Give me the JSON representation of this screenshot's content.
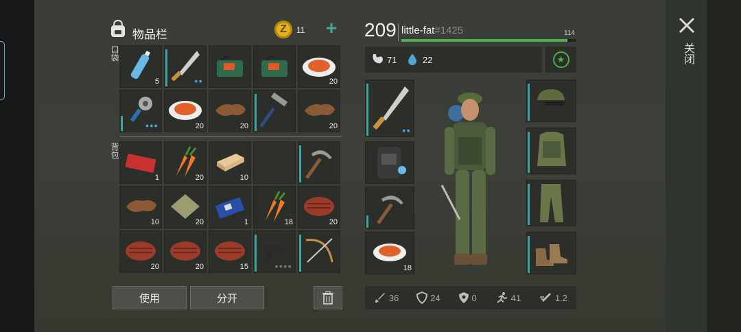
{
  "header": {
    "inventory_title": "物品栏",
    "coins": "11",
    "player_level": "209",
    "player_name": "little-fat",
    "player_tag": "#1425",
    "xp_value": "114",
    "xp_fraction": 0.95,
    "food": "71",
    "water": "22"
  },
  "labels": {
    "pocket": "口袋",
    "backpack": "背包",
    "close": "关闭"
  },
  "buttons": {
    "use": "使用",
    "split": "分开"
  },
  "pocket_counts": [
    "5",
    "",
    "",
    "",
    "20",
    "",
    "20",
    "20",
    "",
    "20"
  ],
  "backpack_counts": [
    "1",
    "20",
    "10",
    "",
    "",
    "10",
    "20",
    "1",
    "18",
    "20",
    "20",
    "20",
    "15",
    "",
    ""
  ],
  "equip_counts": {
    "food": "18"
  },
  "stats": {
    "attack": "36",
    "defense": "24",
    "armor": "0",
    "speed": "41",
    "stealth": "1.2"
  },
  "colors": {
    "accent_green": "#4caf50",
    "durability": "#3aa6a1",
    "water_blue": "#4aa7d6",
    "coin_gold": "#e0b21f"
  },
  "items": {
    "pocket": [
      "water-bottle",
      "machete",
      "dynamite-bundle",
      "dynamite-bundle",
      "cooked-meal",
      "spiked-club",
      "cooked-meal",
      "leather",
      "hammer",
      "leather"
    ],
    "backpack": [
      "combat-coupon",
      "carrot",
      "wood-plank",
      "empty",
      "pickaxe",
      "leather",
      "cloth",
      "circuit-board",
      "carrot",
      "steak",
      "steak",
      "steak",
      "steak",
      "pistol",
      "crossbow"
    ],
    "equipment": [
      "machete",
      "backpack",
      "pickaxe",
      "cooked-meal",
      "cap",
      "vest",
      "camo-pants",
      "boots"
    ]
  }
}
